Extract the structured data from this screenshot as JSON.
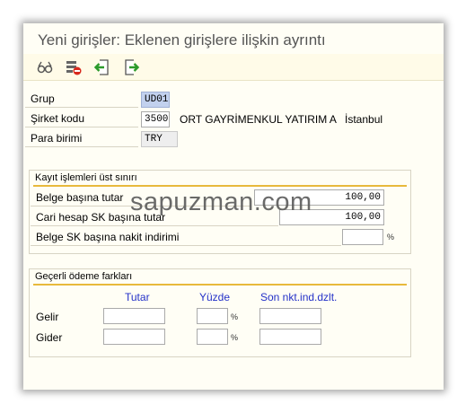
{
  "window": {
    "title": "Yeni girişler: Eklenen girişlere ilişkin ayrıntı"
  },
  "toolbar": [
    {
      "icon": "glasses-icon"
    },
    {
      "icon": "delete-entry-icon"
    },
    {
      "icon": "previous-entry-icon"
    },
    {
      "icon": "next-entry-icon"
    }
  ],
  "header": {
    "grup_label": "Grup",
    "grup_value": "UD01",
    "sirket_label": "Şirket kodu",
    "sirket_value": "3500",
    "sirket_name": "ORT GAYRİMENKUL YATIRIM A",
    "sirket_city": "İstanbul",
    "para_label": "Para birimi",
    "para_value": "TRY"
  },
  "limits": {
    "title": "Kayıt işlemleri üst sınırı",
    "belge_label": "Belge başına tutar",
    "belge_value": "100,00",
    "cari_label": "Cari hesap SK başına tutar",
    "cari_value": "100,00",
    "nakit_label": "Belge SK başına nakit indirimi",
    "nakit_value": "",
    "percent_sign": "%"
  },
  "payment": {
    "title": "Geçerli ödeme farkları",
    "col_tutar": "Tutar",
    "col_yuzde": "Yüzde",
    "col_son": "Son nkt.ind.dzlt.",
    "row_gelir": "Gelir",
    "row_gider": "Gider",
    "percent_sign": "%"
  },
  "watermark": "sapuzman.com"
}
